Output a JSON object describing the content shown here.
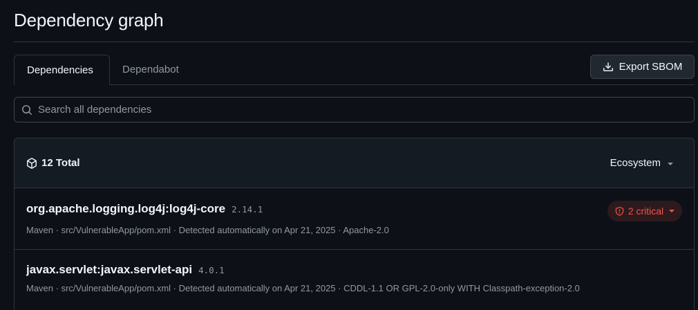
{
  "page": {
    "title": "Dependency graph"
  },
  "tabs": [
    {
      "label": "Dependencies",
      "active": true
    },
    {
      "label": "Dependabot",
      "active": false
    }
  ],
  "toolbar": {
    "export_label": "Export SBOM",
    "export_icon": "download-icon"
  },
  "search": {
    "placeholder": "Search all dependencies",
    "value": "",
    "icon": "search-icon"
  },
  "summary": {
    "total_label": "12 Total",
    "total_icon": "package-icon",
    "filter_label": "Ecosystem"
  },
  "dependencies": [
    {
      "name": "org.apache.logging.log4j:log4j-core",
      "version": "2.14.1",
      "meta": "Maven · src/VulnerableApp/pom.xml · Detected automatically on Apr 21, 2025 · Apache-2.0",
      "alert": "2 critical",
      "alert_icon": "shield-alert-icon"
    },
    {
      "name": "javax.servlet:javax.servlet-api",
      "version": "4.0.1",
      "meta": "Maven · src/VulnerableApp/pom.xml · Detected automatically on Apr 21, 2025 · CDDL-1.1 OR GPL-2.0-only WITH Classpath-exception-2.0"
    }
  ],
  "colors": {
    "background": "#0d1117",
    "border": "#30363d",
    "header_bg": "#151b23",
    "critical": "#f85149",
    "muted_text": "#9198a1"
  }
}
